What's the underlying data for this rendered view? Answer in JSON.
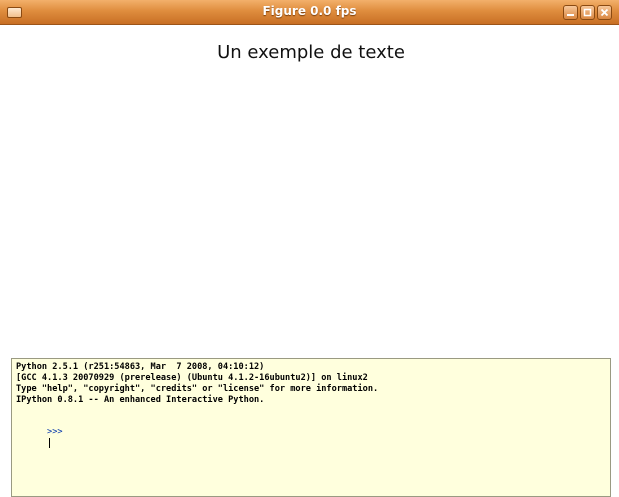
{
  "window": {
    "title": "Figure 0.0 fps",
    "buttons": {
      "minimize_icon": "minimize-icon",
      "maximize_icon": "maximize-icon",
      "close_icon": "close-icon"
    }
  },
  "figure": {
    "text": "Un exemple de texte"
  },
  "console": {
    "lines": [
      "Python 2.5.1 (r251:54863, Mar  7 2008, 04:10:12)",
      "[GCC 4.1.3 20070929 (prerelease) (Ubuntu 4.1.2-16ubuntu2)] on linux2",
      "Type \"help\", \"copyright\", \"credits\" or \"license\" for more information.",
      "IPython 0.8.1 -- An enhanced Interactive Python."
    ],
    "prompt": ">>>",
    "input_value": ""
  },
  "colors": {
    "titlebar": "#df8d3e",
    "console_bg": "#ffffdd"
  }
}
